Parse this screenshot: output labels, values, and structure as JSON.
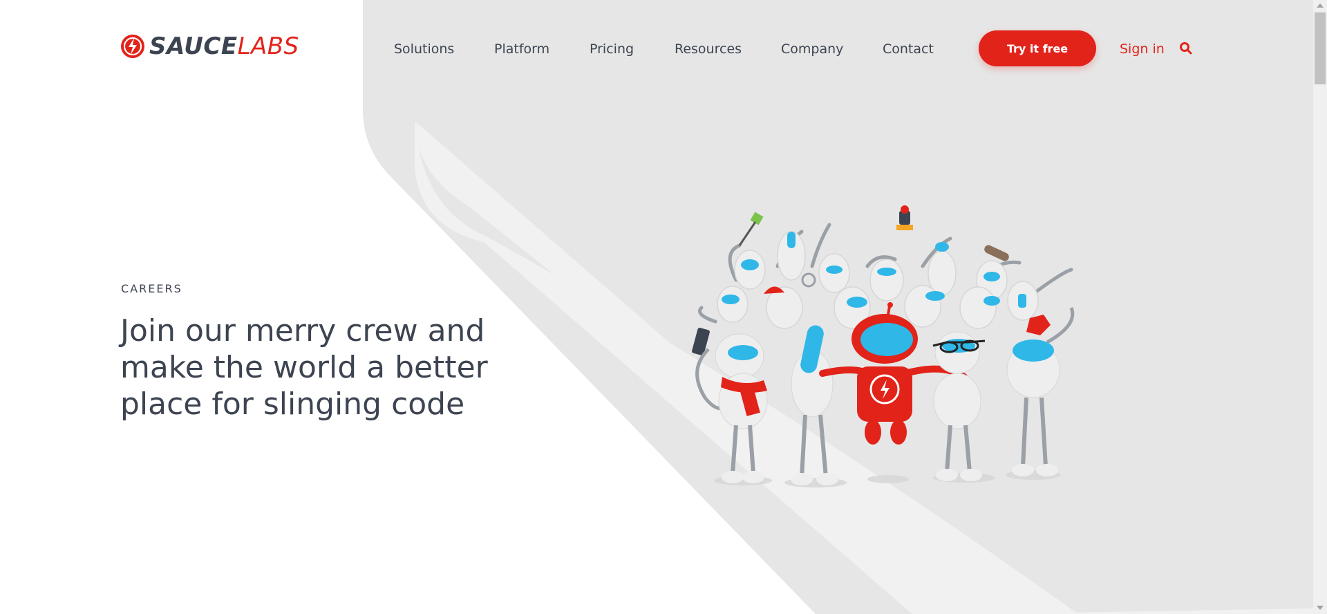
{
  "colors": {
    "brand_red": "#e2231a",
    "text_dark": "#3d4451",
    "panel_gray": "#e6e6e6",
    "panel_light": "#f1f1f1"
  },
  "header": {
    "logo": {
      "icon": "saucelabs-logo-icon",
      "sauce": "SAUCE",
      "labs": "LABS"
    },
    "nav": [
      {
        "label": "Solutions"
      },
      {
        "label": "Platform"
      },
      {
        "label": "Pricing"
      },
      {
        "label": "Resources"
      },
      {
        "label": "Company"
      },
      {
        "label": "Contact"
      }
    ],
    "cta_label": "Try it free",
    "signin_label": "Sign in",
    "search_icon": "search-icon"
  },
  "hero": {
    "eyebrow": "CAREERS",
    "headline_lines": [
      "Join our merry crew and",
      "make the world a better",
      "place for slinging code"
    ],
    "illustration_icon": "robot-crew-illustration"
  }
}
